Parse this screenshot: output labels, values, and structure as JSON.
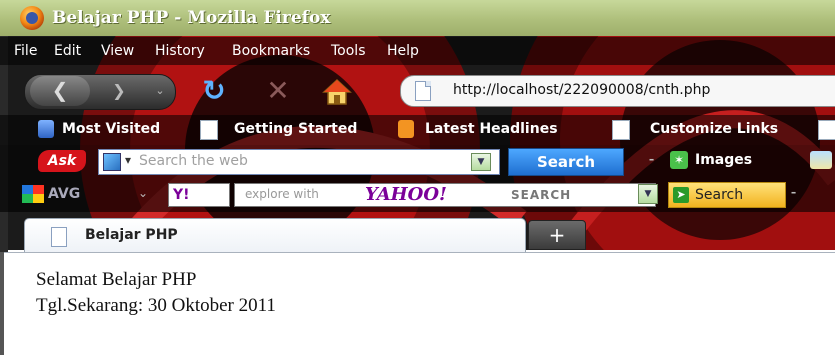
{
  "window": {
    "title": "Belajar PHP - Mozilla Firefox"
  },
  "menu": [
    "File",
    "Edit",
    "View",
    "History",
    "Bookmarks",
    "Tools",
    "Help"
  ],
  "navigation": {
    "url": "http://localhost/222090008/cnth.php"
  },
  "bookmarks": [
    "Most Visited",
    "Getting Started",
    "Latest Headlines",
    "Customize Links"
  ],
  "ask_toolbar": {
    "logo": "Ask",
    "search_placeholder": "Search the web",
    "search_button": "Search",
    "images_label": "Images"
  },
  "yahoo_toolbar": {
    "avg_label": "AVG",
    "yahoo_logo": "Y!",
    "search_placeholder": "explore with",
    "brand": "YAHOO!",
    "brand_suffix": "SEARCH",
    "search_button": "Search"
  },
  "tabs": {
    "active_label": "Belajar PHP",
    "new_tab_label": "+"
  },
  "page": {
    "line1": "Selamat Belajar PHP",
    "line2": "Tgl.Sekarang: 30 Oktober 2011"
  }
}
